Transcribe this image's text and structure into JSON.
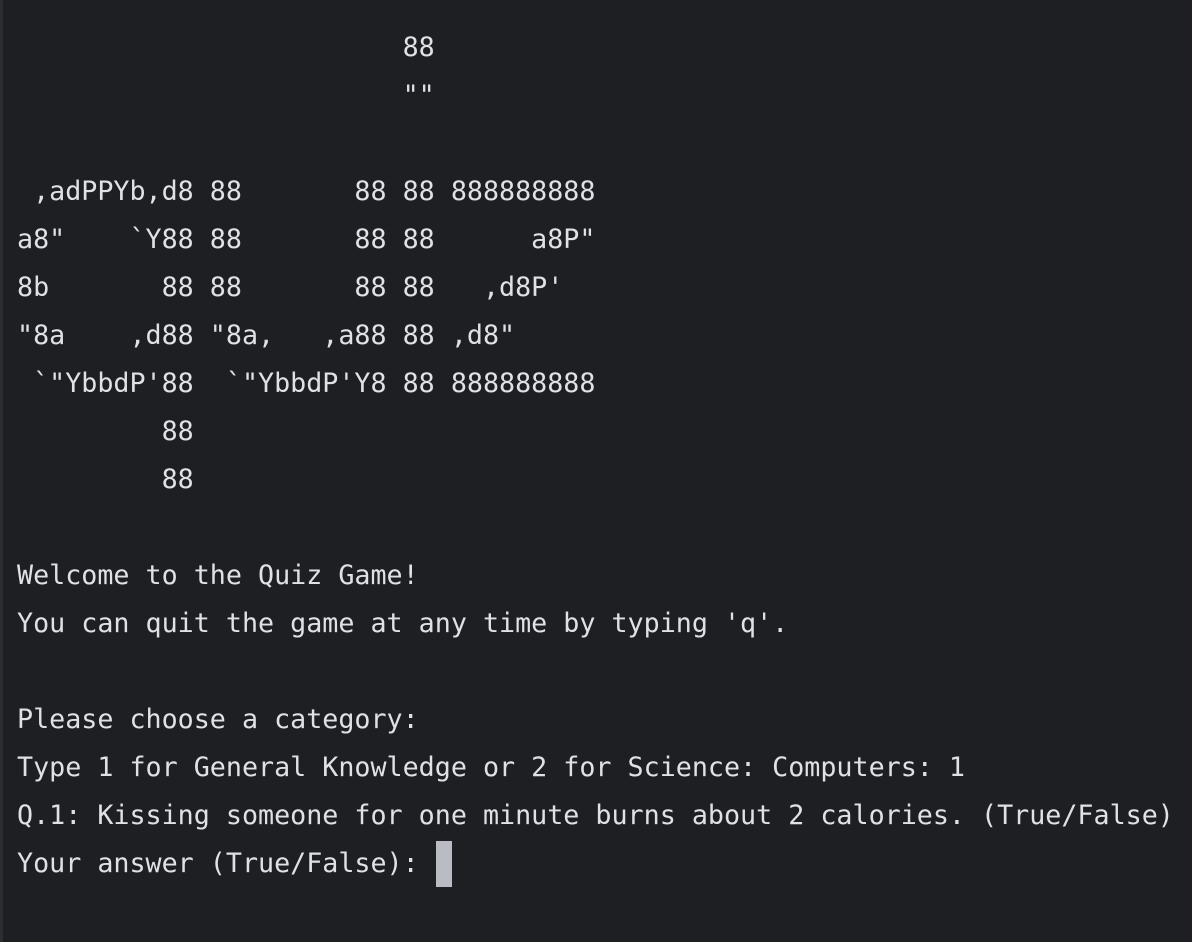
{
  "terminal": {
    "banner_lines": [
      "                        88",
      "                        \"\"",
      "",
      " ,adPPYb,d8 88       88 88 888888888",
      "a8\"    `Y88 88       88 88      a8P\"",
      "8b       88 88       88 88   ,d8P'",
      "\"8a    ,d88 \"8a,   ,a88 88 ,d8\"",
      " `\"YbbdP'88  `\"YbbdP'Y8 88 888888888",
      "         88",
      "         88"
    ],
    "welcome": "Welcome to the Quiz Game!",
    "quit_hint": "You can quit the game at any time by typing 'q'.",
    "choose_category": "Please choose a category:",
    "category_prompt": "Type 1 for General Knowledge or 2 for Science: Computers: 1",
    "question": "Q.1: Kissing someone for one minute burns about 2 calories. (True/False)",
    "answer_prompt": "Your answer (True/False): ",
    "answer_value": ""
  },
  "colors": {
    "background": "#1e1f22",
    "text": "#dfe1e5",
    "cursor": "#b9bcc2"
  }
}
